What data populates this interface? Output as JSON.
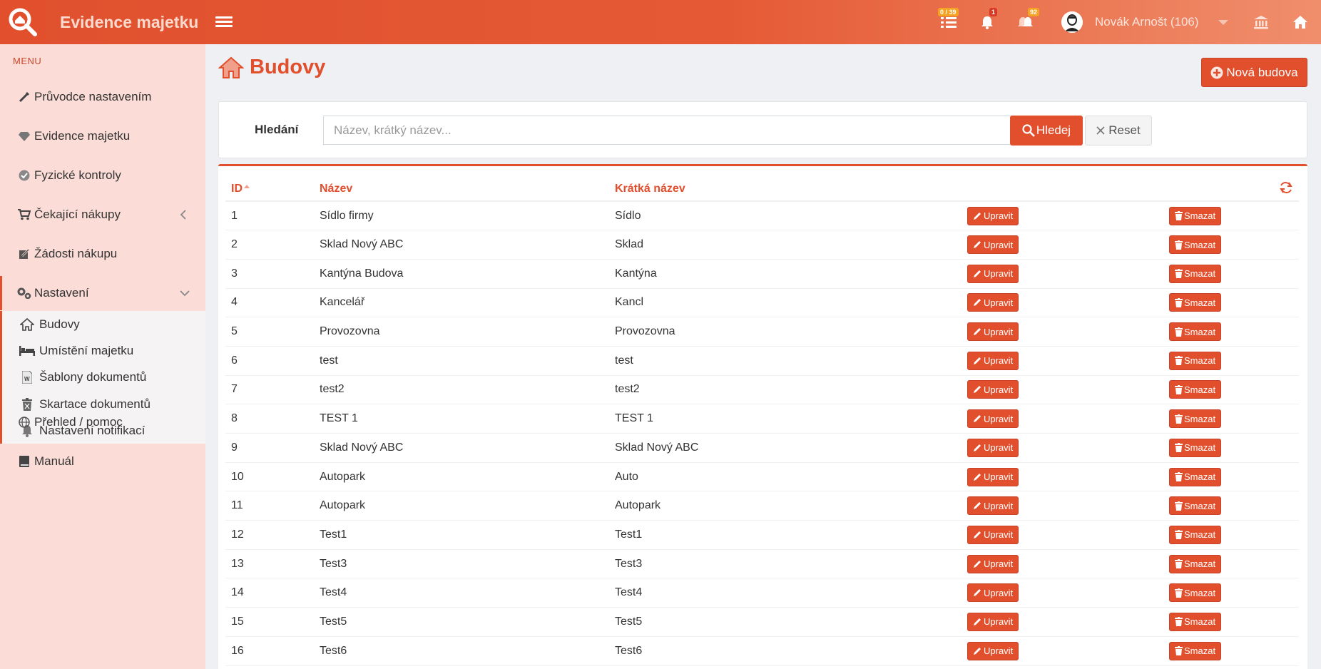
{
  "app": {
    "title": "Evidence majetku"
  },
  "topbar": {
    "tasks_badge": "0 / 39",
    "notifications_badge": "1",
    "alerts_badge": "92",
    "user_name": "Novák Arnošt (106)"
  },
  "sidebar": {
    "menu_header": "MENU",
    "items": [
      {
        "label": "Průvodce nastavením",
        "icon": "wand-icon"
      },
      {
        "label": "Evidence majetku",
        "icon": "diamond-icon"
      },
      {
        "label": "Fyzické kontroly",
        "icon": "check-circle-icon"
      },
      {
        "label": "Čekající nákupy",
        "icon": "cart-icon"
      },
      {
        "label": "Žádosti nákupu",
        "icon": "edit-icon"
      },
      {
        "label": "Nastavení",
        "icon": "gears-icon"
      },
      {
        "label": "Přehled / pomoc",
        "icon": "globe-icon"
      },
      {
        "label": "Manuál",
        "icon": "book-icon"
      }
    ],
    "submenu": [
      {
        "label": "Budovy",
        "icon": "home-icon"
      },
      {
        "label": "Umístění majetku",
        "icon": "bed-icon"
      },
      {
        "label": "Šablony dokumentů",
        "icon": "word-file-icon"
      },
      {
        "label": "Skartace dokumentů",
        "icon": "trash-icon"
      },
      {
        "label": "Nastavení notifikací",
        "icon": "bell-icon"
      }
    ]
  },
  "page": {
    "title": "Budovy",
    "new_button": "Nová budova"
  },
  "search": {
    "label": "Hledání",
    "placeholder": "Název, krátký název...",
    "value": "",
    "search_button": "Hledej",
    "reset_button": "Reset"
  },
  "table": {
    "columns": {
      "id": "ID",
      "name": "Název",
      "short": "Krátká název"
    },
    "edit_label": "Upravit",
    "delete_label": "Smazat",
    "rows": [
      {
        "id": "1",
        "name": "Sídlo firmy",
        "short": "Sídlo"
      },
      {
        "id": "2",
        "name": "Sklad Nový ABC",
        "short": "Sklad"
      },
      {
        "id": "3",
        "name": "Kantýna Budova",
        "short": "Kantýna"
      },
      {
        "id": "4",
        "name": "Kancelář",
        "short": "Kancl"
      },
      {
        "id": "5",
        "name": "Provozovna",
        "short": "Provozovna"
      },
      {
        "id": "6",
        "name": "test",
        "short": "test"
      },
      {
        "id": "7",
        "name": "test2",
        "short": "test2"
      },
      {
        "id": "8",
        "name": "TEST 1",
        "short": "TEST 1"
      },
      {
        "id": "9",
        "name": "Sklad Nový ABC",
        "short": "Sklad Nový ABC"
      },
      {
        "id": "10",
        "name": "Autopark",
        "short": "Auto"
      },
      {
        "id": "11",
        "name": "Autopark",
        "short": "Autopark"
      },
      {
        "id": "12",
        "name": "Test1",
        "short": "Test1"
      },
      {
        "id": "13",
        "name": "Test3",
        "short": "Test3"
      },
      {
        "id": "14",
        "name": "Test4",
        "short": "Test4"
      },
      {
        "id": "15",
        "name": "Test5",
        "short": "Test5"
      },
      {
        "id": "16",
        "name": "Test6",
        "short": "Test6"
      }
    ]
  },
  "colors": {
    "accent": "#e14f2d",
    "sidebar_bg": "#fbdcd6",
    "badge_yellow": "#f4a323"
  }
}
